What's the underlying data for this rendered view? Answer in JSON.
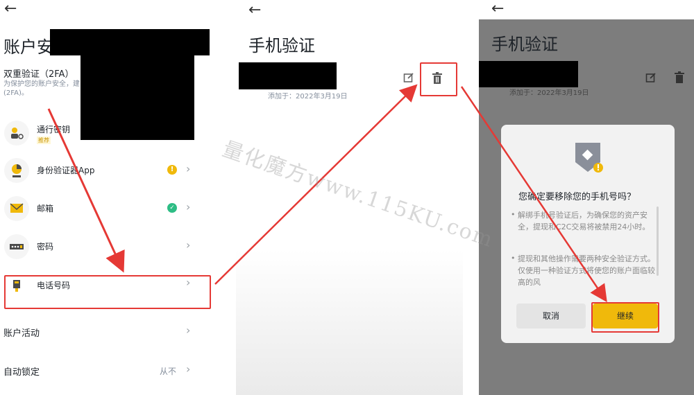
{
  "panel1": {
    "title": "账户安",
    "two_factor": {
      "heading": "双重验证（2FA）",
      "desc_line1": "为保护您的账户安全，建",
      "desc_line2": "(2FA)。"
    },
    "items": [
      {
        "label": "通行密钥",
        "badge": "推荐",
        "icon": "passkey-icon"
      },
      {
        "label": "身份验证器App",
        "status": "warning",
        "icon": "authenticator-icon"
      },
      {
        "label": "邮箱",
        "status": "ok",
        "icon": "email-icon"
      },
      {
        "label": "密码",
        "icon": "password-icon"
      },
      {
        "label": "电话号码",
        "icon": "phone-icon"
      }
    ],
    "account_activity": "账户活动",
    "auto_lock": {
      "label": "自动锁定",
      "value": "从不"
    }
  },
  "panel2": {
    "title": "手机验证",
    "added_on": "添加于：2022年3月19日"
  },
  "panel3": {
    "title": "手机验证",
    "added_on": "添加于：2022年3月19日",
    "dialog": {
      "title": "您确定要移除您的手机号吗？",
      "bullet1": "解绑手机号验证后，为确保您的资产安全，提现和C2C交易将被禁用24小时。",
      "bullet2": "提现和其他操作需要两种安全验证方式。仅使用一种验证方式将使您的账户面临较高的风",
      "cancel_label": "取消",
      "confirm_label": "继续"
    }
  },
  "watermark": "量化魔方www.115KU.com",
  "colors": {
    "accent": "#f0b90b",
    "annotation_red": "#e53935",
    "ok_green": "#2ebd85",
    "warning_yellow": "#f0b90b"
  }
}
